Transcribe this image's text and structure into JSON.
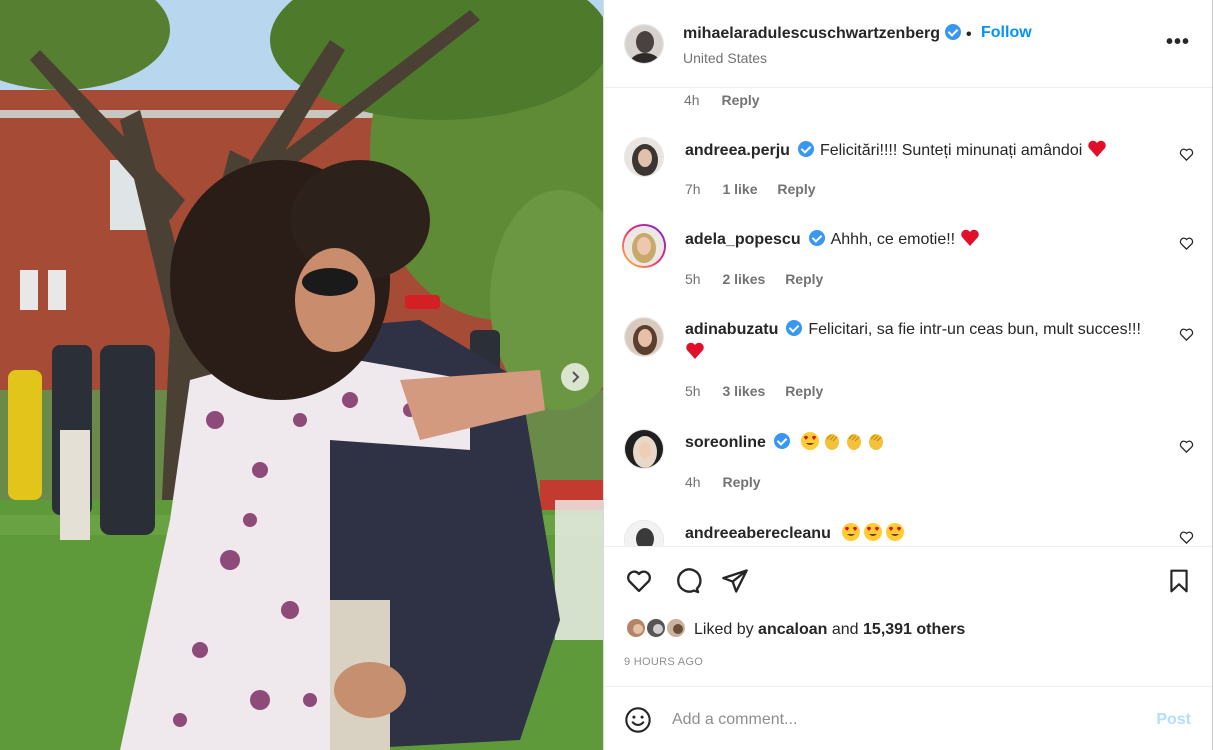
{
  "post": {
    "username": "mihaelaradulescuschwartzenberg",
    "separator": "•",
    "follow_label": "Follow",
    "location": "United States",
    "more_label": "•••"
  },
  "top_meta": {
    "time": "4h",
    "reply": "Reply"
  },
  "comments": [
    {
      "username": "andreea.perju",
      "text": "Felicitări!!!! Sunteți minunați amândoi",
      "time": "7h",
      "likes": "1 like",
      "reply": "Reply"
    },
    {
      "username": "adela_popescu",
      "text": "Ahhh, ce emotie!!",
      "time": "5h",
      "likes": "2 likes",
      "reply": "Reply"
    },
    {
      "username": "adinabuzatu",
      "text": "Felicitari, sa fie intr-un ceas bun, mult succes!!!",
      "time": "5h",
      "likes": "3 likes",
      "reply": "Reply"
    },
    {
      "username": "soreonline",
      "text": "",
      "time": "4h",
      "reply": "Reply"
    },
    {
      "username": "andreeaberecleanu",
      "text": ""
    }
  ],
  "likes": {
    "prefix": "Liked by",
    "user": "ancaloan",
    "and": "and",
    "count": "15,391 others"
  },
  "timestamp": "9 HOURS AGO",
  "add_comment": {
    "placeholder": "Add a comment...",
    "post_label": "Post"
  },
  "colors": {
    "link_blue": "#0095f6",
    "verified": "#3897f0",
    "heart_red": "#e0102b",
    "muted": "#737373"
  },
  "icons": [
    "heart-icon",
    "comment-icon",
    "share-icon",
    "bookmark-icon",
    "smile-icon",
    "verified-icon",
    "more-icon",
    "chevron-right-icon"
  ]
}
